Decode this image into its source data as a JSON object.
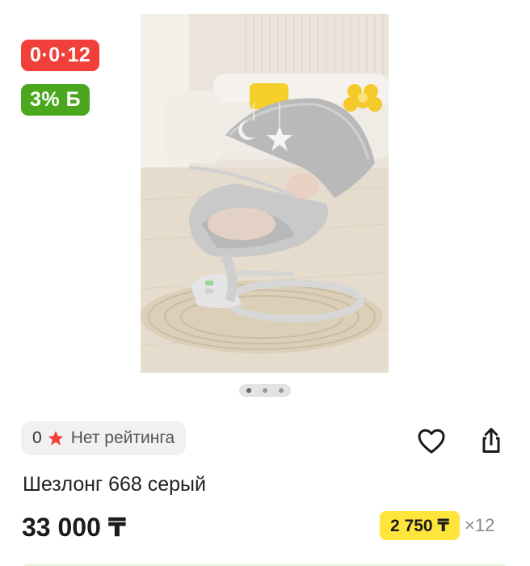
{
  "badges": {
    "installment": "0·0·12",
    "bonus": "3% Б"
  },
  "gallery": {
    "image_icon": "baby-bouncer-product-photo",
    "total_slides": 3,
    "active_slide": 1
  },
  "rating": {
    "count": "0",
    "label": "Нет рейтинга",
    "star_color": "#f1403a"
  },
  "actions": {
    "favorite_icon": "heart-icon",
    "share_icon": "share-icon"
  },
  "product": {
    "title": "Шезлонг 668 серый",
    "price": "33 000 ₸"
  },
  "installment": {
    "monthly_amount": "2 750 ₸",
    "months": "×12",
    "highlight_color": "#ffe53b"
  },
  "colors": {
    "installment_badge": "#f1403a",
    "bonus_badge": "#4ba81e"
  }
}
